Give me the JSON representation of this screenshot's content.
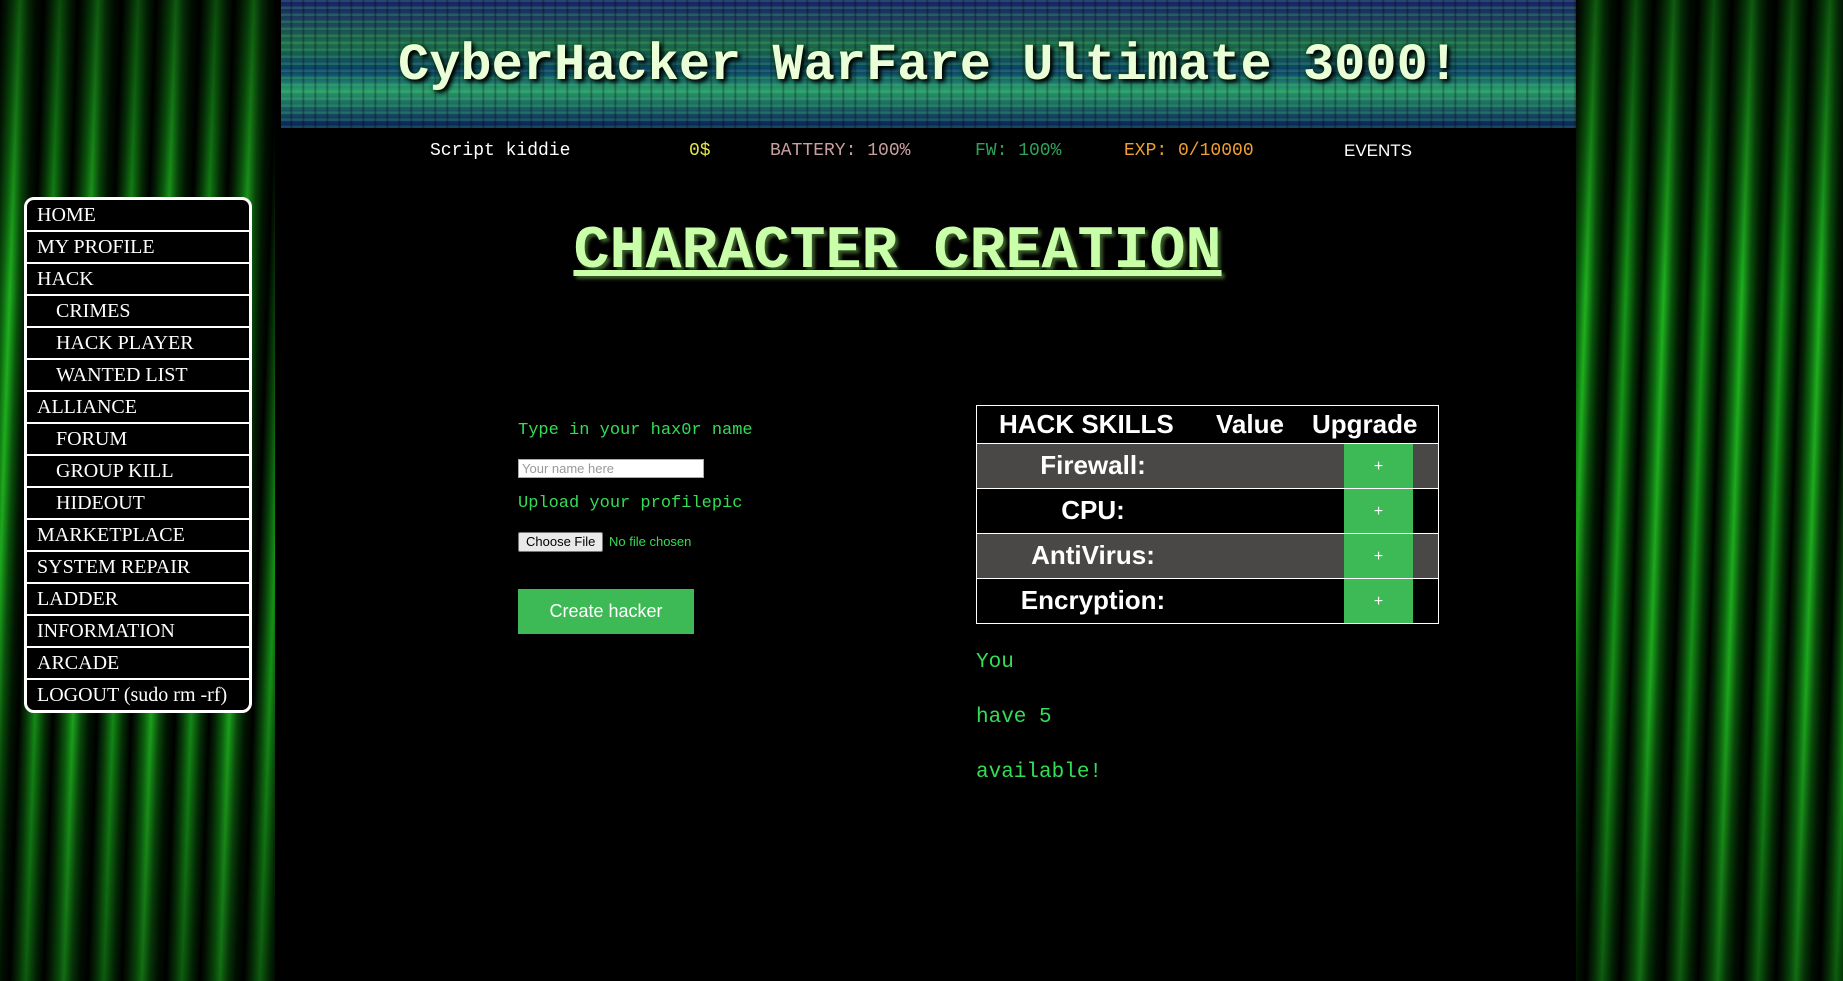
{
  "app": {
    "title": "CyberHacker WarFare Ultimate 3000!"
  },
  "status": {
    "rank": "Script kiddie",
    "money": "0$",
    "battery": "BATTERY: 100%",
    "firewall": "FW: 100%",
    "exp": "EXP: 0/10000",
    "events": "EVENTS"
  },
  "menu": {
    "items": [
      {
        "label": "HOME",
        "sub": false
      },
      {
        "label": "MY PROFILE",
        "sub": false
      },
      {
        "label": "HACK",
        "sub": false
      },
      {
        "label": "CRIMES",
        "sub": true
      },
      {
        "label": "HACK PLAYER",
        "sub": true
      },
      {
        "label": "WANTED LIST",
        "sub": true
      },
      {
        "label": "ALLIANCE",
        "sub": false
      },
      {
        "label": "FORUM",
        "sub": true
      },
      {
        "label": "GROUP KILL",
        "sub": true
      },
      {
        "label": "HIDEOUT",
        "sub": true
      },
      {
        "label": "MARKETPLACE",
        "sub": false
      },
      {
        "label": "SYSTEM REPAIR",
        "sub": false
      },
      {
        "label": "LADDER",
        "sub": false
      },
      {
        "label": "INFORMATION",
        "sub": false
      },
      {
        "label": "ARCADE",
        "sub": false
      },
      {
        "label": "LOGOUT (sudo rm -rf)",
        "sub": false
      }
    ]
  },
  "page": {
    "title": "CHARACTER CREATION"
  },
  "form": {
    "name_label": "Type in your hax0r name",
    "name_placeholder": "Your name here",
    "name_value": "",
    "pic_label": "Upload your profilepic",
    "file_button": "Choose File",
    "file_status": "No file chosen",
    "submit_label": "Create hacker"
  },
  "skills": {
    "headers": {
      "skill": "HACK SKILLS",
      "value": "Value",
      "upgrade": "Upgrade"
    },
    "rows": [
      {
        "name": "Firewall:",
        "value": "",
        "upgrade": "+"
      },
      {
        "name": "CPU:",
        "value": "",
        "upgrade": "+"
      },
      {
        "name": "AntiVirus:",
        "value": "",
        "upgrade": "+"
      },
      {
        "name": "Encryption:",
        "value": "",
        "upgrade": "+"
      }
    ]
  },
  "points": {
    "line1": "You",
    "line2": "have 5",
    "line3": "available!"
  },
  "colors": {
    "accent_green": "#3dba55",
    "text_green": "#33dd55",
    "title_green": "#c8ffa8",
    "money_yellow": "#e6e64a",
    "exp_orange": "#f0a030"
  }
}
